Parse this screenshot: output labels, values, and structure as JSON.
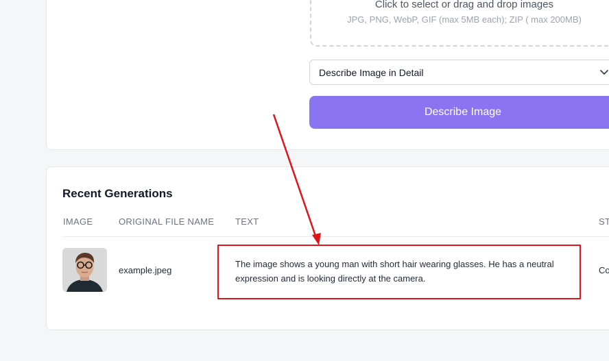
{
  "upload": {
    "title": "Click to select or drag and drop images",
    "formats": "JPG, PNG, WebP, GIF (max 5MB each); ZIP ( max 200MB)"
  },
  "mode_select": {
    "value": "Describe Image in Detail",
    "icon": "chevron-down-icon"
  },
  "describe_button": {
    "label": "Describe Image"
  },
  "recent": {
    "title": "Recent Generations",
    "columns": [
      "IMAGE",
      "ORIGINAL FILE NAME",
      "TEXT",
      "ST"
    ],
    "rows": [
      {
        "image_alt": "young man with glasses",
        "file_name": "example.jpeg",
        "text": "The image shows a young man with short hair wearing glasses. He has a neutral expression and is looking directly at the camera.",
        "status": "Co"
      }
    ]
  },
  "annotation": {
    "color": "#e0121a"
  },
  "colors": {
    "accent": "#8b74f2",
    "background": "#f5f6f8"
  }
}
